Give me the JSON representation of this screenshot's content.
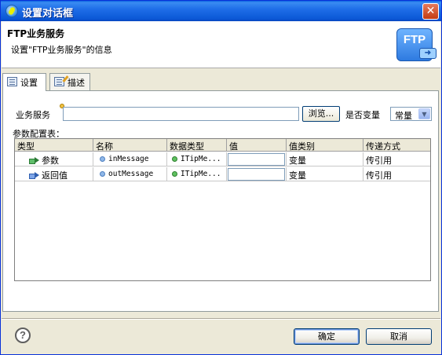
{
  "window": {
    "title": "设置对话框",
    "close_glyph": "✕"
  },
  "banner": {
    "heading": "FTP业务服务",
    "description": "设置\"FTP业务服务\"的信息",
    "logo_text": "FTP",
    "logo_arrow": "➜"
  },
  "tabs": [
    {
      "label": "设置",
      "icon": "settings-page-icon",
      "active": true
    },
    {
      "label": "描述",
      "icon": "description-page-icon",
      "active": false
    }
  ],
  "form": {
    "service_label": "业务服务",
    "service_value": "",
    "browse_label": "浏览...",
    "is_variable_label": "是否变量",
    "variable_select": {
      "selected": "常量",
      "arrow_glyph": "▼"
    },
    "params_table_label": "参数配置表："
  },
  "table": {
    "columns": [
      "类型",
      "名称",
      "数据类型",
      "值",
      "值类别",
      "传递方式"
    ],
    "rows": [
      {
        "type": "参数",
        "type_icon": "param-in-icon",
        "name": "inMessage",
        "data_type": "ITipMe...",
        "value": "",
        "value_category": "变量",
        "pass_mode": "传引用"
      },
      {
        "type": "返回值",
        "type_icon": "param-out-icon",
        "name": "outMessage",
        "data_type": "ITipMe...",
        "value": "",
        "value_category": "变量",
        "pass_mode": "传引用"
      }
    ]
  },
  "footer": {
    "help_glyph": "?",
    "ok_label": "确定",
    "cancel_label": "取消"
  },
  "colors": {
    "titlebar": "#0b58d6",
    "dialog_bg": "#ece9d8",
    "button_border": "#003c74"
  }
}
